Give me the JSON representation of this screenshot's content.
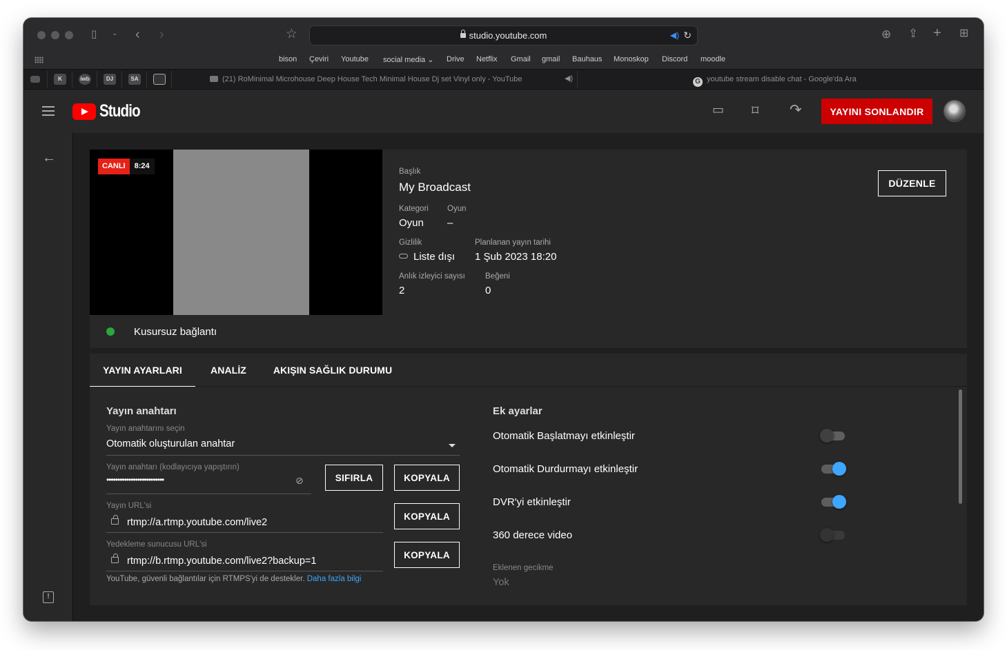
{
  "browser": {
    "address": "studio.youtube.com",
    "favorites": [
      "bison",
      "Çeviri",
      "Youtube",
      "social media",
      "Drive",
      "Netflix",
      "Gmail",
      "gmail",
      "Bauhaus",
      "Monoskop",
      "Discord",
      "moodle"
    ],
    "pinned_tabs": [
      "K",
      "iwb",
      "DJ",
      "SA"
    ],
    "tab_youtube": "(21) RoMinimal Microhouse Deep House Tech Minimal House Dj set Vinyl only - YouTube",
    "tab_google": "youtube stream disable chat - Google'da Ara"
  },
  "studio": {
    "logo_text": "Studio",
    "end_stream_label": "YAYINI SONLANDIR"
  },
  "broadcast": {
    "live_badge": "CANLI",
    "live_time": "8:24",
    "connection_status": "Kusursuz bağlantı",
    "title_label": "Başlık",
    "title": "My Broadcast",
    "category_label": "Kategori",
    "category": "Oyun",
    "game_label": "Oyun",
    "game": "–",
    "privacy_label": "Gizlilik",
    "privacy": "Liste dışı",
    "scheduled_label": "Planlanan yayın tarihi",
    "scheduled": "1 Şub 2023 18:20",
    "viewers_label": "Anlık izleyici sayısı",
    "viewers": "2",
    "likes_label": "Beğeni",
    "likes": "0",
    "edit_label": "DÜZENLE"
  },
  "tabs": [
    "YAYIN AYARLARI",
    "ANALİZ",
    "AKIŞIN SAĞLIK DURUMU"
  ],
  "stream_key": {
    "section_title": "Yayın anahtarı",
    "select_label": "Yayın anahtarını seçin",
    "select_value": "Otomatik oluşturulan anahtar",
    "key_label": "Yayın anahtarı (kodlayıcıya yapıştırın)",
    "key_value": "••••••••••••••••••••••••••",
    "reset_label": "SIFIRLA",
    "copy_label": "KOPYALA",
    "url_label": "Yayın URL'si",
    "url_value": "rtmp://a.rtmp.youtube.com/live2",
    "backup_label": "Yedekleme sunucusu URL'si",
    "backup_value": "rtmp://b.rtmp.youtube.com/live2?backup=1",
    "note": "YouTube, güvenli bağlantılar için RTMPS'yi de destekler.",
    "note_link": "Daha fazla bilgi"
  },
  "additional": {
    "section_title": "Ek ayarlar",
    "toggles": [
      {
        "label": "Otomatik Başlatmayı etkinleştir",
        "on": false
      },
      {
        "label": "Otomatik Durdurmayı etkinleştir",
        "on": true
      },
      {
        "label": "DVR'yi etkinleştir",
        "on": true
      },
      {
        "label": "360 derece video",
        "on": false
      }
    ],
    "latency_label": "Eklenen gecikme",
    "latency_value": "Yok"
  }
}
